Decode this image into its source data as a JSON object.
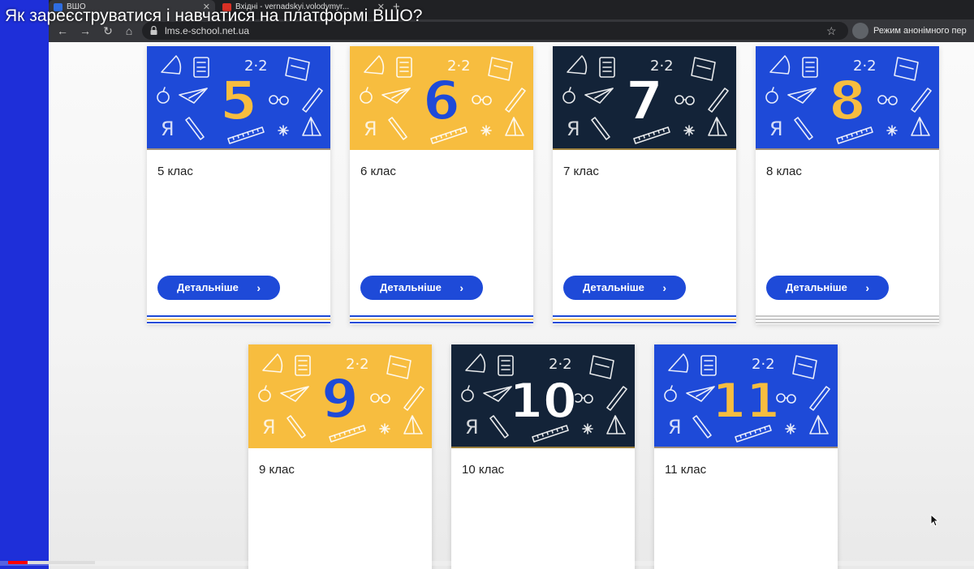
{
  "video": {
    "title": "Як зареєструватися і навчатися на платформі ВШО?",
    "progress_played": 0.02,
    "progress_buffered": 0.07
  },
  "browser": {
    "tabs": [
      {
        "label": "ВШО",
        "icon": "school-favicon",
        "active": true
      },
      {
        "label": "Вхідні - vernadskyi.volodymyr...",
        "icon": "gmail-icon",
        "active": false
      }
    ],
    "url": "lms.e-school.net.ua",
    "incognito_label": "Режим анонімного пер"
  },
  "colors": {
    "blue": "#1e4ad8",
    "yellow": "#f7bd3f",
    "navy": "#132338",
    "white": "#ffffff"
  },
  "courses": [
    {
      "number": "5",
      "title": "5 клас",
      "button": "Детальніше",
      "theme": "blue"
    },
    {
      "number": "6",
      "title": "6 клас",
      "button": "Детальніше",
      "theme": "yellow"
    },
    {
      "number": "7",
      "title": "7 клас",
      "button": "Детальніше",
      "theme": "navy"
    },
    {
      "number": "8",
      "title": "8 клас",
      "button": "Детальніше",
      "theme": "blue"
    },
    {
      "number": "9",
      "title": "9 клас",
      "theme": "yellow"
    },
    {
      "number": "10",
      "title": "10 клас",
      "theme": "navy"
    },
    {
      "number": "11",
      "title": "11 клас",
      "theme": "blue"
    }
  ]
}
